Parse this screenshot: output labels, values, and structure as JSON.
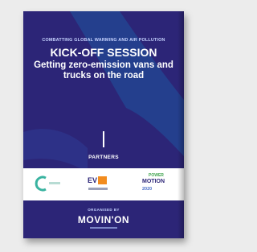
{
  "cover": {
    "tagline": "COMBATTING GLOBAL WARMING AND AIR POLLUTION",
    "title": "KICK-OFF SESSION",
    "subtitle": "Getting zero-emission vans and trucks on the road",
    "partners_label": "PARTNERS",
    "organized_by": "ORGANISED BY",
    "brand": "MOVIN'ON"
  },
  "partner_logos": [
    {
      "icon": "c-partner-logo"
    },
    {
      "icon": "ev-partner-logo",
      "text": "EV"
    },
    {
      "icon": "transition-partner-logo",
      "top": "POWER",
      "mid": "MOTION",
      "bot": "2020"
    }
  ],
  "colors": {
    "background": "#2c2577",
    "accent_shape": "#24428f",
    "text": "#ffffff",
    "ev_orange": "#f28c1e"
  }
}
